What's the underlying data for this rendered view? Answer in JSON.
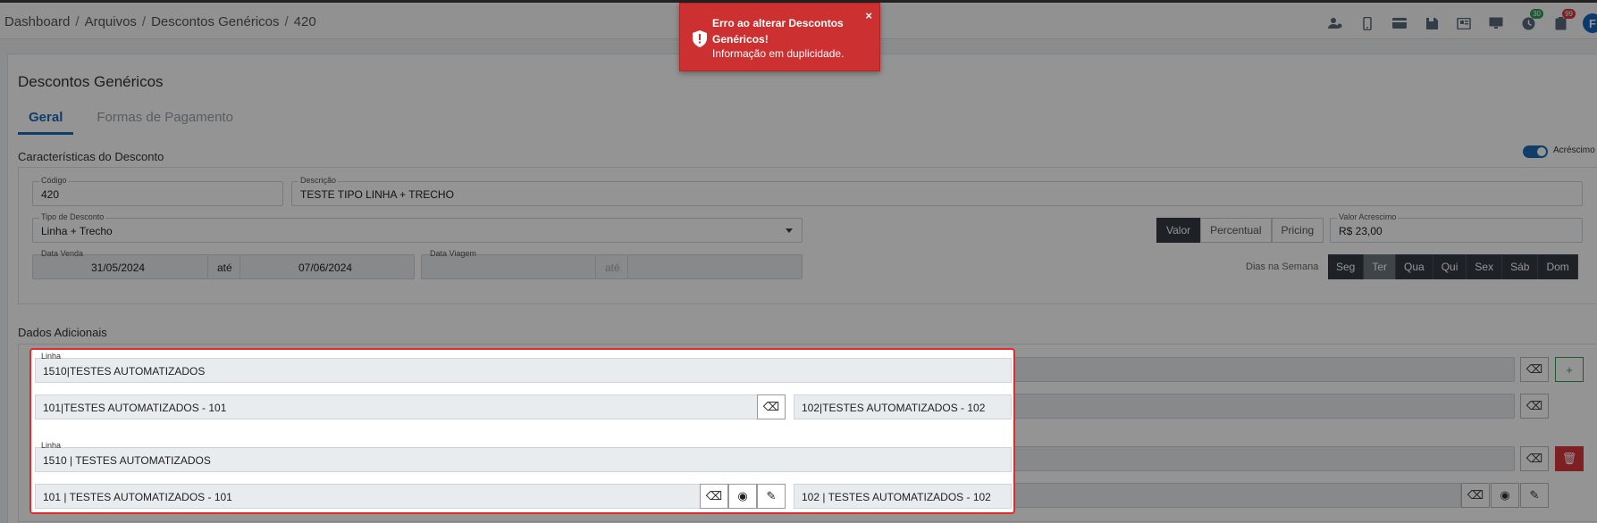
{
  "breadcrumb": [
    "Dashboard",
    "Arquivos",
    "Descontos Genéricos",
    "420"
  ],
  "topbar": {
    "icons": [
      "user-gear-icon",
      "mobile-icon",
      "card-icon",
      "save-icon",
      "news-icon",
      "monitor-icon",
      "clock-icon",
      "clipboard-icon"
    ],
    "badge_clock": "30",
    "badge_clipboard": "99",
    "avatar_letter": "F"
  },
  "page": {
    "title": "Descontos Genéricos",
    "tabs": [
      "Geral",
      "Formas de Pagamento"
    ]
  },
  "caracteristicas": {
    "title": "Características do Desconto",
    "toggle_label": "Acréscimo",
    "codigo_label": "Código",
    "codigo_value": "420",
    "descricao_label": "Descrição",
    "descricao_value": "TESTE TIPO LINHA + TRECHO",
    "tipo_label": "Tipo de Desconto",
    "tipo_value": "Linha + Trecho",
    "valor_buttons": [
      "Valor",
      "Percentual",
      "Pricing"
    ],
    "valor_acrescimo_label": "Valor Acrescimo",
    "valor_acrescimo_value": "R$ 23,00",
    "data_venda_label": "Data Venda",
    "data_venda_from": "31/05/2024",
    "ate": "até",
    "data_venda_to": "07/06/2024",
    "data_viagem_label": "Data Viagem",
    "dias_label": "Dias na Semana",
    "dias": [
      "Seg",
      "Ter",
      "Qua",
      "Qui",
      "Sex",
      "Sáb",
      "Dom"
    ]
  },
  "dados": {
    "title": "Dados Adicionais",
    "linha_label": "Linha",
    "linha1_value": "1510|TESTES AUTOMATIZADOS",
    "trecho1_origem": "101|TESTES AUTOMATIZADOS - 101",
    "trecho1_destino": "102|TESTES AUTOMATIZADOS - 102",
    "linha2_value": "1510 | TESTES AUTOMATIZADOS",
    "trecho2_origem": "101 | TESTES AUTOMATIZADOS - 101",
    "trecho2_destino": "102 | TESTES AUTOMATIZADOS - 102"
  },
  "toast": {
    "title": "Erro ao alterar Descontos Genéricos!",
    "message": "Informação em duplicidade.",
    "close": "×",
    "color": "#cc3030"
  }
}
